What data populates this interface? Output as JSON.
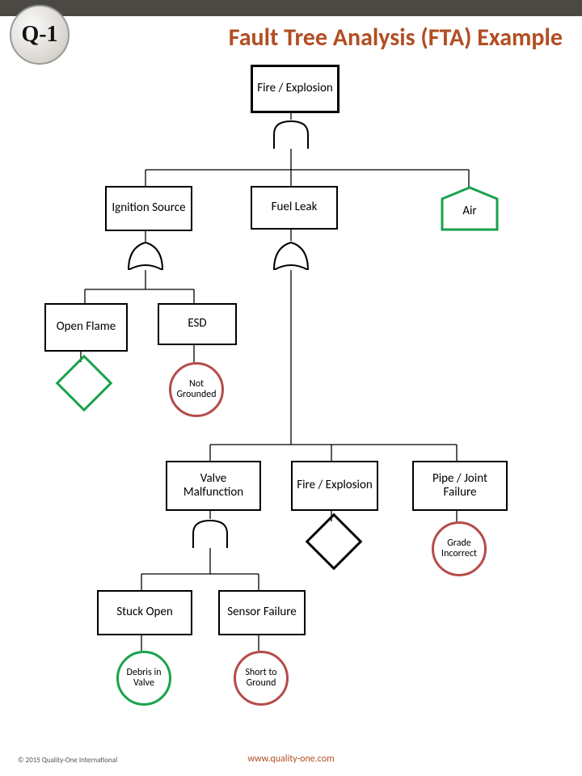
{
  "logo_text": "Q-1",
  "title": "Fault Tree Analysis (FTA) Example",
  "footer_left": "© 2015 Quality-One International",
  "footer_center": "www.quality-one.com",
  "nodes": {
    "top": "Fire / Explosion",
    "ignition": "Ignition Source",
    "fuel": "Fuel Leak",
    "air": "Air",
    "open_flame": "Open Flame",
    "esd": "ESD",
    "not_grounded": "Not Grounded",
    "valve_malf": "Valve Malfunction",
    "fire_exp2": "Fire / Explosion",
    "pipe_joint": "Pipe / Joint Failure",
    "grade": "Grade Incorrect",
    "stuck_open": "Stuck Open",
    "sensor_fail": "Sensor Failure",
    "debris": "Debris in Valve",
    "short": "Short to Ground"
  },
  "colors": {
    "red": "#b64b4b",
    "green": "#1aa24d",
    "title": "#b24e23"
  },
  "chart_data": {
    "type": "fault-tree",
    "top_event": "Fire / Explosion",
    "structure": {
      "event": "Fire / Explosion",
      "gate": "AND",
      "children": [
        {
          "event": "Ignition Source",
          "gate": "OR",
          "children": [
            {
              "event": "Open Flame",
              "terminator": "undeveloped",
              "color": "green"
            },
            {
              "event": "ESD",
              "terminator": "basic",
              "basic_label": "Not Grounded",
              "color": "red"
            }
          ]
        },
        {
          "event": "Fuel Leak",
          "gate": "OR",
          "children": [
            {
              "event": "Valve Malfunction",
              "gate": "AND",
              "children": [
                {
                  "event": "Stuck Open",
                  "terminator": "basic",
                  "basic_label": "Debris in Valve",
                  "color": "green"
                },
                {
                  "event": "Sensor Failure",
                  "terminator": "basic",
                  "basic_label": "Short to Ground",
                  "color": "red"
                }
              ]
            },
            {
              "event": "Fire / Explosion",
              "terminator": "undeveloped",
              "color": "black"
            },
            {
              "event": "Pipe / Joint Failure",
              "terminator": "basic",
              "basic_label": "Grade Incorrect",
              "color": "red"
            }
          ]
        },
        {
          "event": "Air",
          "terminator": "external",
          "color": "green"
        }
      ]
    }
  }
}
